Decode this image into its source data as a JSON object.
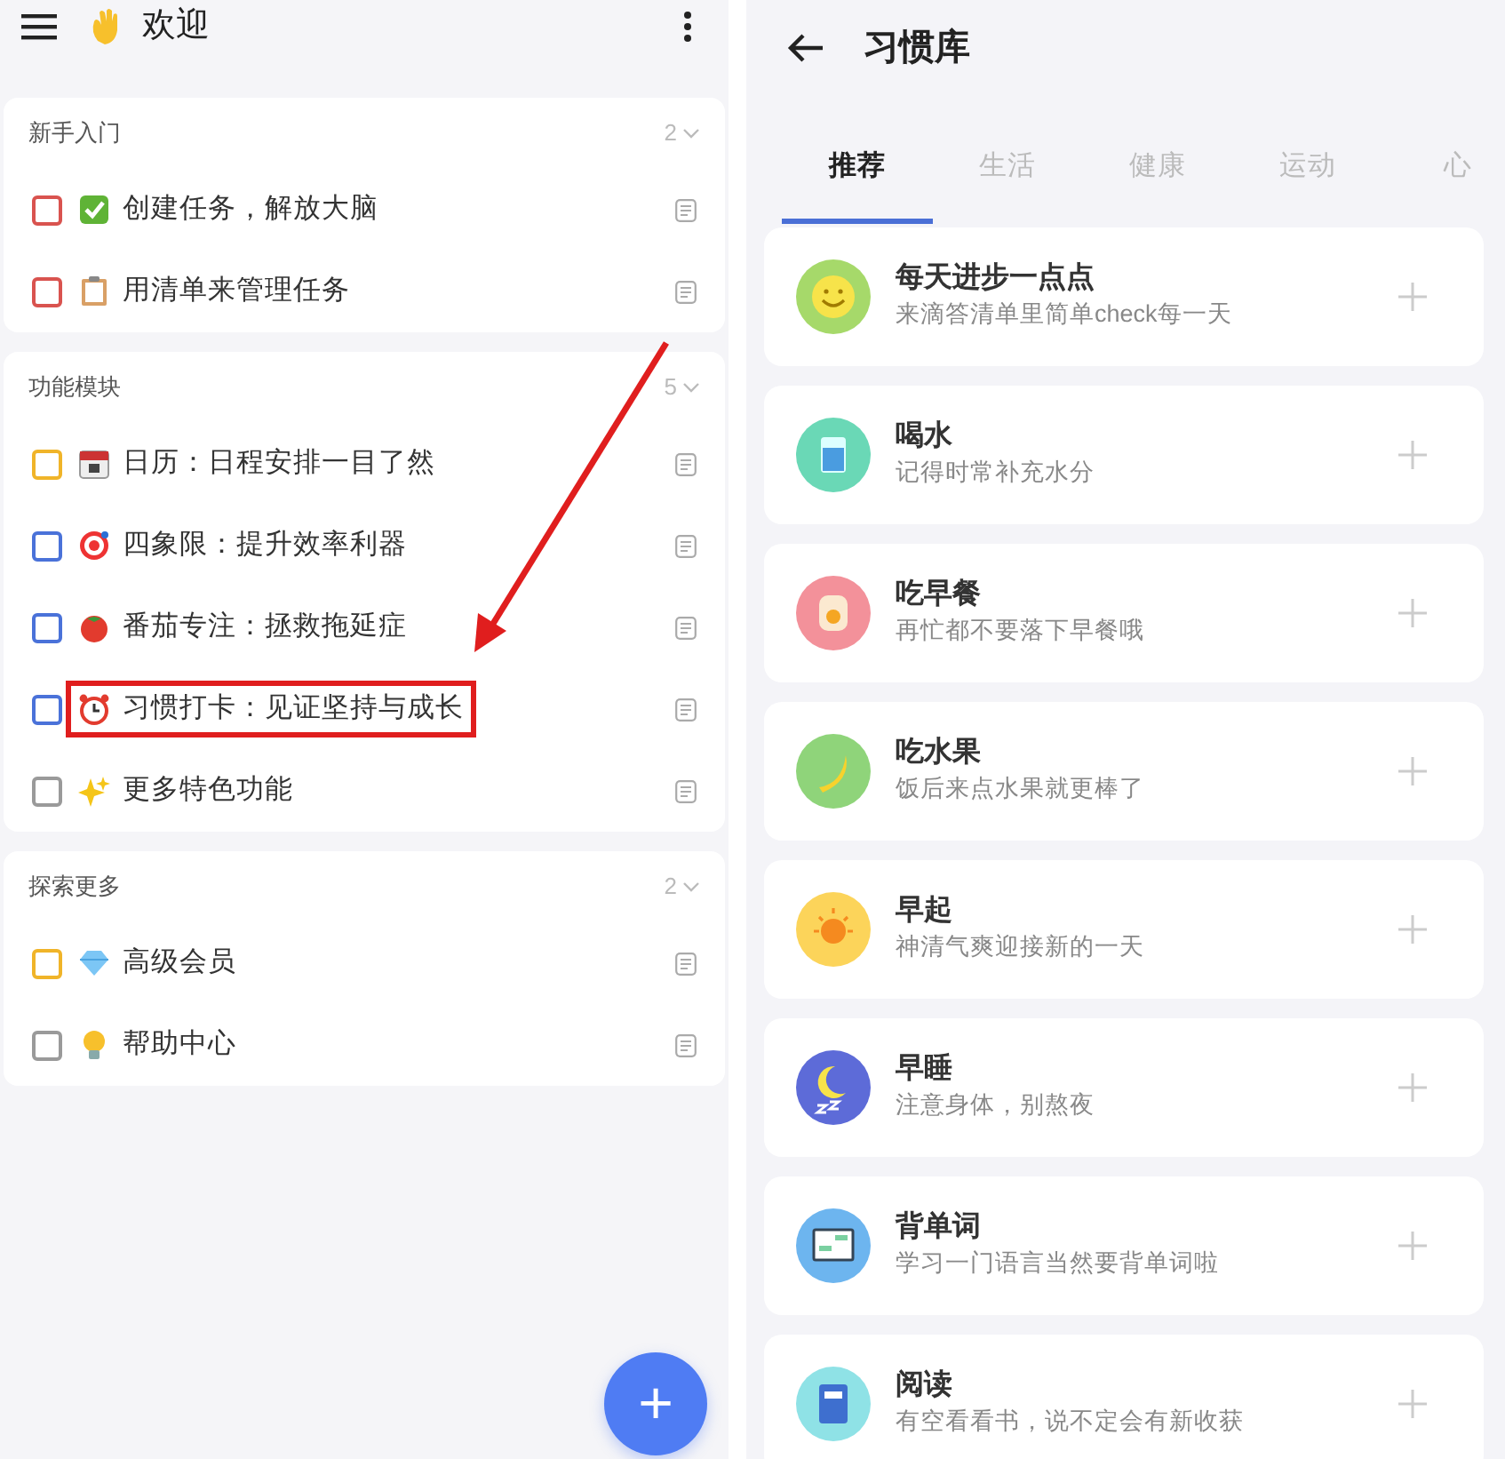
{
  "left_screen": {
    "title": "欢迎",
    "sections": [
      {
        "title": "新手入门",
        "count": "2",
        "expanded": true,
        "items": [
          {
            "text": "创建任务，解放大脑",
            "checked": false,
            "color": "#d9534f",
            "highlighted": false
          },
          {
            "text": "用清单来管理任务",
            "checked": false,
            "color": "#d9534f",
            "highlighted": false
          }
        ]
      },
      {
        "title": "功能模块",
        "count": "5",
        "expanded": true,
        "items": [
          {
            "text": "日历：日程安排一目了然",
            "checked": false,
            "color": "#f0b429",
            "highlighted": false
          },
          {
            "text": "四象限：提升效率利器",
            "checked": false,
            "color": "#4a72d9",
            "highlighted": false
          },
          {
            "text": "番茄专注：拯救拖延症",
            "checked": false,
            "color": "#4a72d9",
            "highlighted": false
          },
          {
            "text": "习惯打卡：见证坚持与成长",
            "checked": false,
            "color": "#4a72d9",
            "highlighted": true
          },
          {
            "text": "更多特色功能",
            "checked": false,
            "color": "#9a9a9a",
            "highlighted": false
          }
        ]
      },
      {
        "title": "探索更多",
        "count": "2",
        "expanded": true,
        "items": [
          {
            "text": "高级会员",
            "checked": false,
            "color": "#f0b429",
            "highlighted": false
          },
          {
            "text": "帮助中心",
            "checked": false,
            "color": "#9a9a9a",
            "highlighted": false
          }
        ]
      }
    ],
    "fab": "+"
  },
  "right_screen": {
    "title": "习惯库",
    "tabs": [
      {
        "label": "推荐",
        "selected": true
      },
      {
        "label": "生活",
        "selected": false
      },
      {
        "label": "健康",
        "selected": false
      },
      {
        "label": "运动",
        "selected": false
      },
      {
        "label": "心",
        "selected": false
      }
    ],
    "habits": [
      {
        "name": "每天进步一点点",
        "description": "来滴答清单里简单check每一天"
      },
      {
        "name": "喝水",
        "description": "记得时常补充水分"
      },
      {
        "name": "吃早餐",
        "description": "再忙都不要落下早餐哦"
      },
      {
        "name": "吃水果",
        "description": "饭后来点水果就更棒了"
      },
      {
        "name": "早起",
        "description": "神清气爽迎接新的一天"
      },
      {
        "name": "早睡",
        "description": "注意身体，别熬夜"
      },
      {
        "name": "背单词",
        "description": "学习一门语言当然要背单词啦"
      },
      {
        "name": "阅读",
        "description": "有空看看书，说不定会有新收获"
      }
    ]
  }
}
